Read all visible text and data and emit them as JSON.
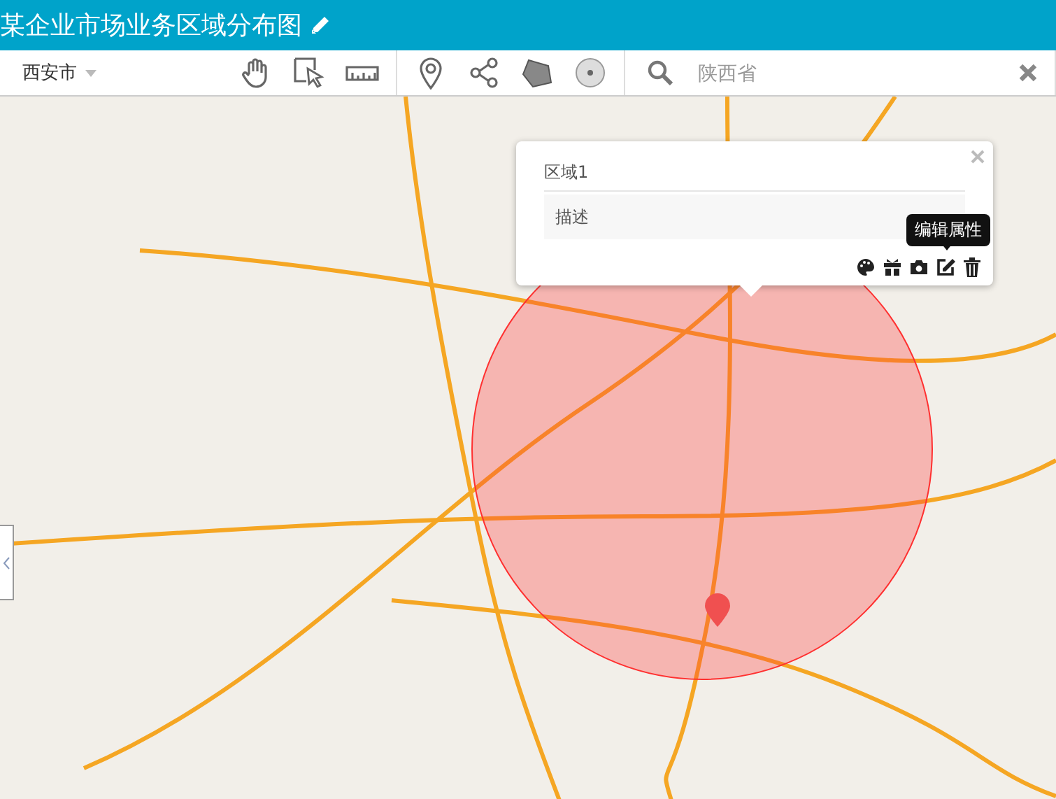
{
  "header": {
    "title": "某企业市场业务区域分布图"
  },
  "toolbar": {
    "city_select": {
      "value": "西安市"
    },
    "tools": [
      {
        "kind": "hand"
      },
      {
        "kind": "select"
      },
      {
        "kind": "ruler"
      },
      {
        "kind": "marker"
      },
      {
        "kind": "line"
      },
      {
        "kind": "polygon"
      },
      {
        "kind": "circle"
      }
    ],
    "search": {
      "placeholder": "陕西省"
    }
  },
  "popup": {
    "title": "区域1",
    "description": "描述",
    "tooltip": "编辑属性",
    "actions": [
      {
        "kind": "palette"
      },
      {
        "kind": "gift"
      },
      {
        "kind": "camera"
      },
      {
        "kind": "edit"
      },
      {
        "kind": "delete"
      }
    ]
  }
}
